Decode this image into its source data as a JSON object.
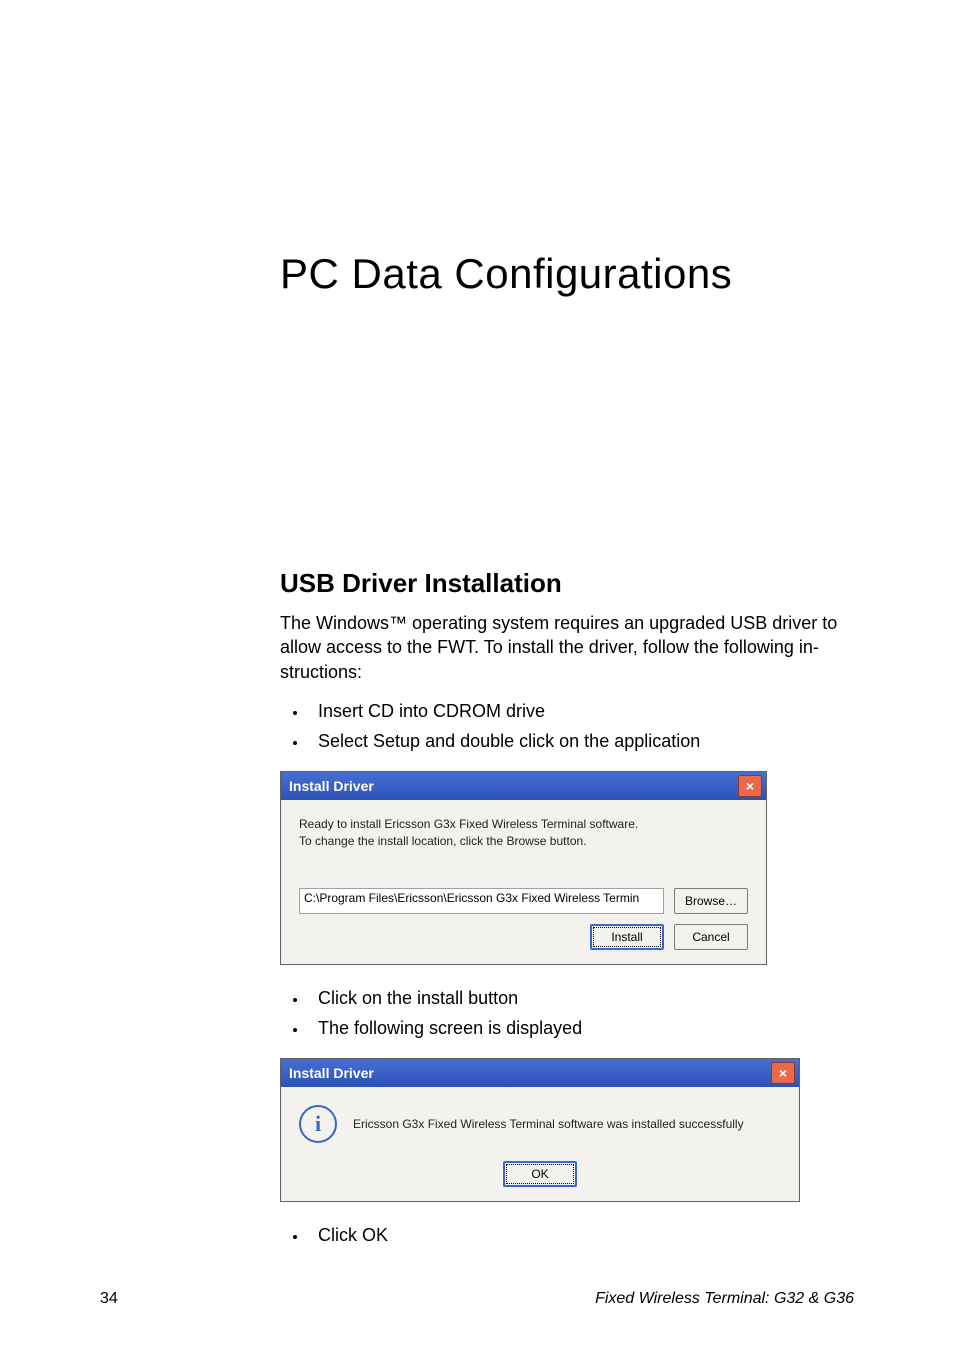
{
  "heading": "PC Data Configurations",
  "section_title": "USB Driver Installation",
  "intro_para": "The Windows™ operating system requires an upgraded USB driver to allow access to the FWT. To install the driver, follow the following in-structions:",
  "bullets1": [
    "Insert CD into CDROM drive",
    "Select Setup and double click on the application"
  ],
  "dialog1": {
    "title": "Install Driver",
    "close_icon": "×",
    "line1": "Ready to install Ericsson G3x Fixed Wireless Terminal software.",
    "line2": "To change the install location, click the Browse button.",
    "path": "C:\\Program Files\\Ericsson\\Ericsson G3x Fixed Wireless Termin",
    "browse": "Browse…",
    "install": "Install",
    "cancel": "Cancel"
  },
  "bullets2": [
    "Click on the install button",
    "The following screen is displayed"
  ],
  "dialog2": {
    "title": "Install Driver",
    "close_icon": "×",
    "info_glyph": "i",
    "msg": "Ericsson G3x Fixed Wireless Terminal software was installed successfully",
    "ok": "OK"
  },
  "bullets3": [
    "Click OK"
  ],
  "footer": {
    "page": "34",
    "doc": "Fixed Wireless Terminal: G32 & G36"
  }
}
